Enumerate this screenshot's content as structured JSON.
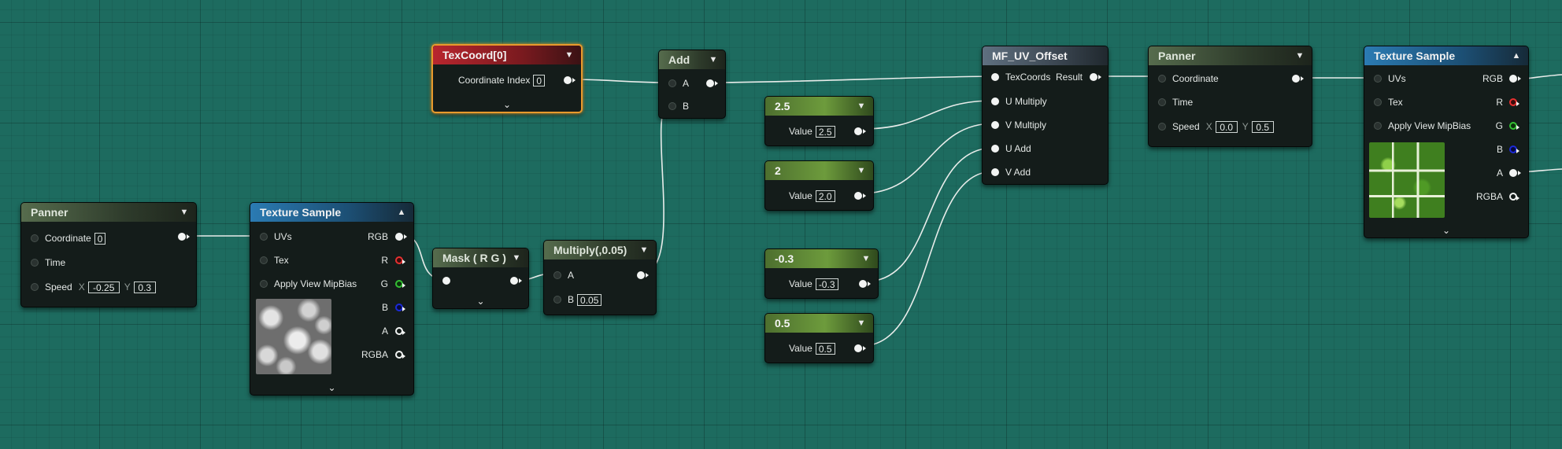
{
  "nodes": {
    "panner_left": {
      "title": "Panner",
      "coordinate_label": "Coordinate",
      "coordinate_value": "0",
      "time_label": "Time",
      "speed_label": "Speed",
      "x_label": "X",
      "x_value": "-0.25",
      "y_label": "Y",
      "y_value": "0.3"
    },
    "texture_sample_left": {
      "title": "Texture Sample",
      "uvs_label": "UVs",
      "tex_label": "Tex",
      "mipbias_label": "Apply View MipBias",
      "rgb_label": "RGB",
      "r_label": "R",
      "g_label": "G",
      "b_label": "B",
      "a_label": "A",
      "rgba_label": "RGBA",
      "thumbnail": "grayscale-noise-texture"
    },
    "texcoord": {
      "title": "TexCoord[0]",
      "coordinate_index_label": "Coordinate Index",
      "coordinate_index_value": "0"
    },
    "mask": {
      "title": "Mask ( R G )"
    },
    "multiply": {
      "title": "Multiply(,0.05)",
      "a_label": "A",
      "b_label": "B",
      "b_value": "0.05"
    },
    "add": {
      "title": "Add",
      "a_label": "A",
      "b_label": "B"
    },
    "const_25": {
      "title": "2.5",
      "value_label": "Value",
      "value": "2.5"
    },
    "const_2": {
      "title": "2",
      "value_label": "Value",
      "value": "2.0"
    },
    "const_m03": {
      "title": "-0.3",
      "value_label": "Value",
      "value": "-0.3"
    },
    "const_05": {
      "title": "0.5",
      "value_label": "Value",
      "value": "0.5"
    },
    "mf_uv_offset": {
      "title": "MF_UV_Offset",
      "texcoords_label": "TexCoords",
      "result_label": "Result",
      "u_multiply_label": "U Multiply",
      "v_multiply_label": "V Multiply",
      "u_add_label": "U Add",
      "v_add_label": "V Add"
    },
    "panner_right": {
      "title": "Panner",
      "coordinate_label": "Coordinate",
      "time_label": "Time",
      "speed_label": "Speed",
      "x_label": "X",
      "x_value": "0.0",
      "y_label": "Y",
      "y_value": "0.5"
    },
    "texture_sample_right": {
      "title": "Texture Sample",
      "uvs_label": "UVs",
      "tex_label": "Tex",
      "mipbias_label": "Apply View MipBias",
      "rgb_label": "RGB",
      "r_label": "R",
      "g_label": "G",
      "b_label": "B",
      "a_label": "A",
      "rgba_label": "RGBA",
      "thumbnail": "green-grass-tile-texture"
    }
  },
  "colors": {
    "canvas": "#1d6b5f",
    "node_body": "#141c1a",
    "selection": "#e89a2c",
    "wire": "#e8ecea"
  },
  "icons": {
    "collapse": "chevron-down-icon",
    "expand_preview": "chevron-up-icon"
  }
}
